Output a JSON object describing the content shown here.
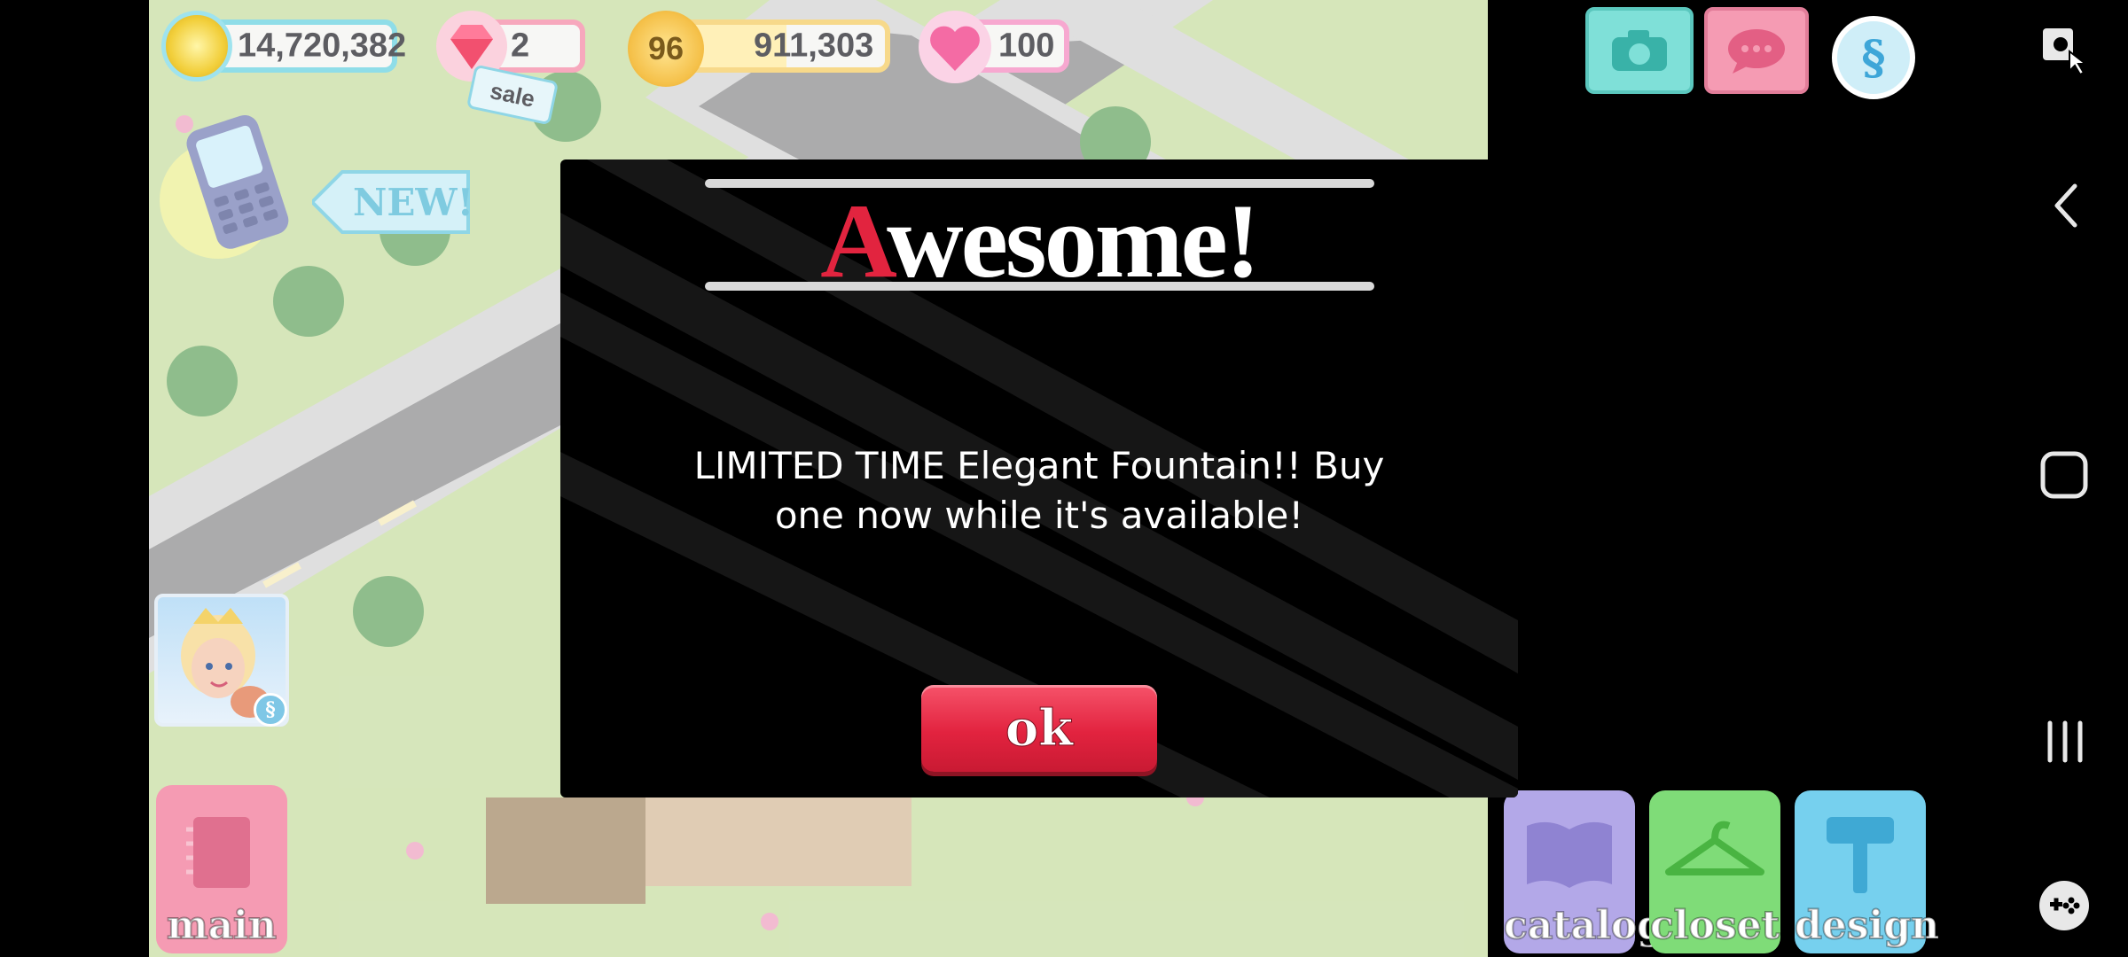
{
  "hud": {
    "coins": "14,720,382",
    "gems": "2",
    "gems_sale": "sale",
    "level": "96",
    "xp": "911,303",
    "hearts": "100"
  },
  "side": {
    "new_badge": "NEW!"
  },
  "bottom": {
    "main": "main",
    "catalog": "catalog",
    "closet": "closet",
    "design": "design"
  },
  "dialog": {
    "title_first": "A",
    "title_rest": "wesome!",
    "message": "LIMITED TIME Elegant Fountain!! Buy one now while it's available!",
    "ok": "ok"
  },
  "colors": {
    "accent_red": "#e2243f",
    "hud_border": "#8fdde8",
    "catalog": "#a79be0",
    "closet": "#6fd36a",
    "design": "#5cc6e8",
    "main": "#f27a96"
  },
  "icons": [
    "coin-icon",
    "gem-icon",
    "star-level-icon",
    "heart-icon",
    "camera-icon",
    "chat-icon",
    "s-badge-icon",
    "phone-icon",
    "avatar",
    "notebook-icon",
    "book-icon",
    "hanger-icon",
    "hammer-icon",
    "screen-pin-icon",
    "back-icon",
    "home-icon",
    "recents-icon",
    "gamepad-icon"
  ]
}
